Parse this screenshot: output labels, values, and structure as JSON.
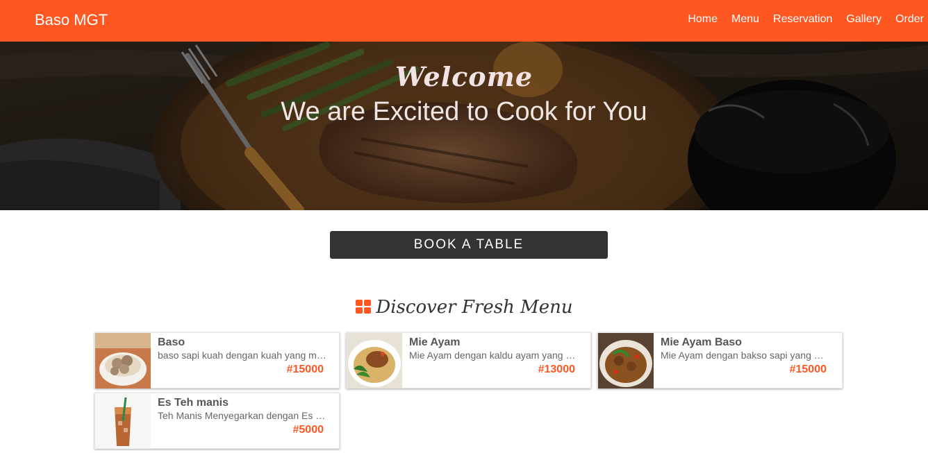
{
  "navbar": {
    "brand": "Baso MGT",
    "links": [
      "Home",
      "Menu",
      "Reservation",
      "Gallery",
      "Order"
    ],
    "color": "#ff5722"
  },
  "hero": {
    "welcome": "Welcome",
    "tagline": "We are Excited to Cook for You"
  },
  "book_button": {
    "label": "BOOK A TABLE"
  },
  "menu_section": {
    "title": "Discover Fresh Menu",
    "icon": "grid-icon",
    "items": [
      {
        "name": "Baso",
        "description": "baso sapi kuah dengan kuah yang menyegarkan",
        "price": "#15000"
      },
      {
        "name": "Mie Ayam",
        "description": "Mie Ayam dengan kaldu ayam yang menggugah selera",
        "price": "#13000"
      },
      {
        "name": "Mie Ayam Baso",
        "description": "Mie Ayam dengan bakso sapi yang menggugah selera",
        "price": "#15000"
      },
      {
        "name": "Es Teh manis",
        "description": "Teh Manis Menyegarkan dengan Es batu",
        "price": "#5000"
      }
    ]
  }
}
